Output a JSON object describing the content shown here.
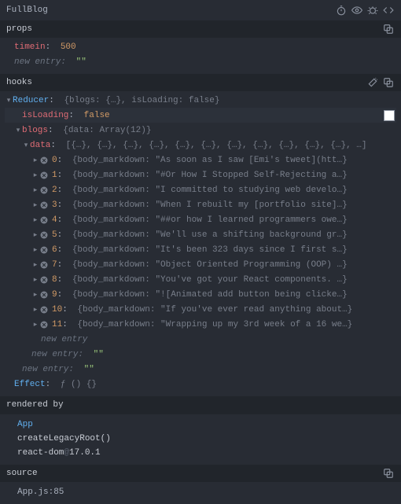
{
  "header": {
    "title": "FullBlog",
    "icons": [
      "stopwatch",
      "eye",
      "bug",
      "code"
    ]
  },
  "props": {
    "section_label": "props",
    "timein_key": "timein",
    "timein_value": "500",
    "new_entry_label": "new entry",
    "new_entry_value": "\"\"",
    "copy_icon": "copy"
  },
  "hooks": {
    "section_label": "hooks",
    "wand_icon": "magic-wand",
    "copy_icon": "copy",
    "reducer_label": "Reducer",
    "reducer_preview": "{blogs: {…}, isLoading: false}",
    "isLoading_key": "isLoading",
    "isLoading_value": "false",
    "blogs_key": "blogs",
    "blogs_preview": "{data: Array(12)}",
    "data_key": "data",
    "data_preview": "[{…}, {…}, {…}, {…}, {…}, {…}, {…}, {…}, {…}, {…}, {…}, …]",
    "items": [
      {
        "index": "0",
        "preview": "{body_markdown: \"As soon as I saw [Emi's tweet](htt…}"
      },
      {
        "index": "1",
        "preview": "{body_markdown: \"#Or How I Stopped Self-Rejecting a…}"
      },
      {
        "index": "2",
        "preview": "{body_markdown: \"I committed to studying web develo…}"
      },
      {
        "index": "3",
        "preview": "{body_markdown: \"When I rebuilt my [portfolio site]…}"
      },
      {
        "index": "4",
        "preview": "{body_markdown: \"##or how I learned programmers owe…}"
      },
      {
        "index": "5",
        "preview": "{body_markdown: \"We'll use a shifting background gr…}"
      },
      {
        "index": "6",
        "preview": "{body_markdown: \"It's been 323 days since I first s…}"
      },
      {
        "index": "7",
        "preview": "{body_markdown: \"Object Oriented Programming (OOP) …}"
      },
      {
        "index": "8",
        "preview": "{body_markdown: \"You've got your React components. …}"
      },
      {
        "index": "9",
        "preview": "{body_markdown: \"![Animated add button being clicke…}"
      },
      {
        "index": "10",
        "preview": "{body_markdown: \"If you've ever read anything about…}"
      },
      {
        "index": "11",
        "preview": "{body_markdown: \"Wrapping up my 3rd week of a 16 we…}"
      }
    ],
    "inner_new_entry": "new entry",
    "mid_new_entry_label": "new entry",
    "mid_new_entry_value": "\"\"",
    "outer_new_entry_label": "new entry",
    "outer_new_entry_value": "\"\"",
    "effect_label": "Effect",
    "effect_value": "ƒ () {}"
  },
  "rendered_by": {
    "section_label": "rendered by",
    "app_link": "App",
    "create_legacy": "createLegacyRoot()",
    "react_dom_name": "react-dom",
    "react_dom_version": "17.0.1"
  },
  "source": {
    "section_label": "source",
    "copy_icon": "copy",
    "file": "App.js:85"
  },
  "chart_data": null
}
